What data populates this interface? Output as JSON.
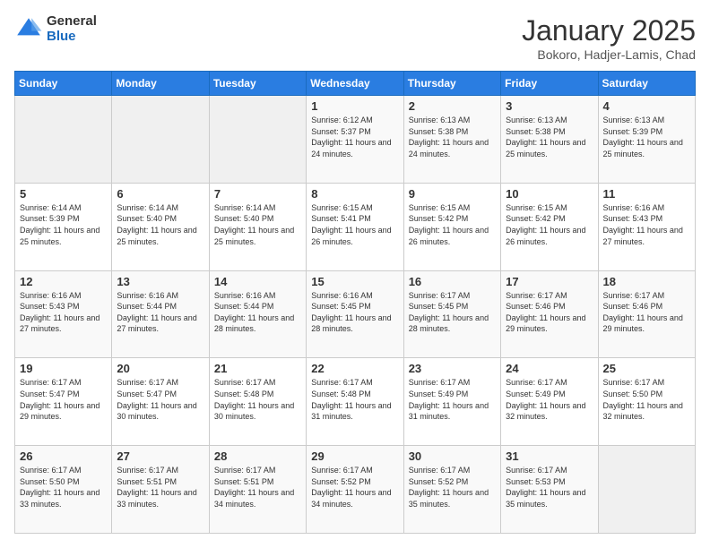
{
  "logo": {
    "general": "General",
    "blue": "Blue"
  },
  "title": {
    "main": "January 2025",
    "sub": "Bokoro, Hadjer-Lamis, Chad"
  },
  "days_of_week": [
    "Sunday",
    "Monday",
    "Tuesday",
    "Wednesday",
    "Thursday",
    "Friday",
    "Saturday"
  ],
  "weeks": [
    [
      {
        "day": "",
        "info": ""
      },
      {
        "day": "",
        "info": ""
      },
      {
        "day": "",
        "info": ""
      },
      {
        "day": "1",
        "info": "Sunrise: 6:12 AM\nSunset: 5:37 PM\nDaylight: 11 hours and 24 minutes."
      },
      {
        "day": "2",
        "info": "Sunrise: 6:13 AM\nSunset: 5:38 PM\nDaylight: 11 hours and 24 minutes."
      },
      {
        "day": "3",
        "info": "Sunrise: 6:13 AM\nSunset: 5:38 PM\nDaylight: 11 hours and 25 minutes."
      },
      {
        "day": "4",
        "info": "Sunrise: 6:13 AM\nSunset: 5:39 PM\nDaylight: 11 hours and 25 minutes."
      }
    ],
    [
      {
        "day": "5",
        "info": "Sunrise: 6:14 AM\nSunset: 5:39 PM\nDaylight: 11 hours and 25 minutes."
      },
      {
        "day": "6",
        "info": "Sunrise: 6:14 AM\nSunset: 5:40 PM\nDaylight: 11 hours and 25 minutes."
      },
      {
        "day": "7",
        "info": "Sunrise: 6:14 AM\nSunset: 5:40 PM\nDaylight: 11 hours and 25 minutes."
      },
      {
        "day": "8",
        "info": "Sunrise: 6:15 AM\nSunset: 5:41 PM\nDaylight: 11 hours and 26 minutes."
      },
      {
        "day": "9",
        "info": "Sunrise: 6:15 AM\nSunset: 5:42 PM\nDaylight: 11 hours and 26 minutes."
      },
      {
        "day": "10",
        "info": "Sunrise: 6:15 AM\nSunset: 5:42 PM\nDaylight: 11 hours and 26 minutes."
      },
      {
        "day": "11",
        "info": "Sunrise: 6:16 AM\nSunset: 5:43 PM\nDaylight: 11 hours and 27 minutes."
      }
    ],
    [
      {
        "day": "12",
        "info": "Sunrise: 6:16 AM\nSunset: 5:43 PM\nDaylight: 11 hours and 27 minutes."
      },
      {
        "day": "13",
        "info": "Sunrise: 6:16 AM\nSunset: 5:44 PM\nDaylight: 11 hours and 27 minutes."
      },
      {
        "day": "14",
        "info": "Sunrise: 6:16 AM\nSunset: 5:44 PM\nDaylight: 11 hours and 28 minutes."
      },
      {
        "day": "15",
        "info": "Sunrise: 6:16 AM\nSunset: 5:45 PM\nDaylight: 11 hours and 28 minutes."
      },
      {
        "day": "16",
        "info": "Sunrise: 6:17 AM\nSunset: 5:45 PM\nDaylight: 11 hours and 28 minutes."
      },
      {
        "day": "17",
        "info": "Sunrise: 6:17 AM\nSunset: 5:46 PM\nDaylight: 11 hours and 29 minutes."
      },
      {
        "day": "18",
        "info": "Sunrise: 6:17 AM\nSunset: 5:46 PM\nDaylight: 11 hours and 29 minutes."
      }
    ],
    [
      {
        "day": "19",
        "info": "Sunrise: 6:17 AM\nSunset: 5:47 PM\nDaylight: 11 hours and 29 minutes."
      },
      {
        "day": "20",
        "info": "Sunrise: 6:17 AM\nSunset: 5:47 PM\nDaylight: 11 hours and 30 minutes."
      },
      {
        "day": "21",
        "info": "Sunrise: 6:17 AM\nSunset: 5:48 PM\nDaylight: 11 hours and 30 minutes."
      },
      {
        "day": "22",
        "info": "Sunrise: 6:17 AM\nSunset: 5:48 PM\nDaylight: 11 hours and 31 minutes."
      },
      {
        "day": "23",
        "info": "Sunrise: 6:17 AM\nSunset: 5:49 PM\nDaylight: 11 hours and 31 minutes."
      },
      {
        "day": "24",
        "info": "Sunrise: 6:17 AM\nSunset: 5:49 PM\nDaylight: 11 hours and 32 minutes."
      },
      {
        "day": "25",
        "info": "Sunrise: 6:17 AM\nSunset: 5:50 PM\nDaylight: 11 hours and 32 minutes."
      }
    ],
    [
      {
        "day": "26",
        "info": "Sunrise: 6:17 AM\nSunset: 5:50 PM\nDaylight: 11 hours and 33 minutes."
      },
      {
        "day": "27",
        "info": "Sunrise: 6:17 AM\nSunset: 5:51 PM\nDaylight: 11 hours and 33 minutes."
      },
      {
        "day": "28",
        "info": "Sunrise: 6:17 AM\nSunset: 5:51 PM\nDaylight: 11 hours and 34 minutes."
      },
      {
        "day": "29",
        "info": "Sunrise: 6:17 AM\nSunset: 5:52 PM\nDaylight: 11 hours and 34 minutes."
      },
      {
        "day": "30",
        "info": "Sunrise: 6:17 AM\nSunset: 5:52 PM\nDaylight: 11 hours and 35 minutes."
      },
      {
        "day": "31",
        "info": "Sunrise: 6:17 AM\nSunset: 5:53 PM\nDaylight: 11 hours and 35 minutes."
      },
      {
        "day": "",
        "info": ""
      }
    ]
  ]
}
